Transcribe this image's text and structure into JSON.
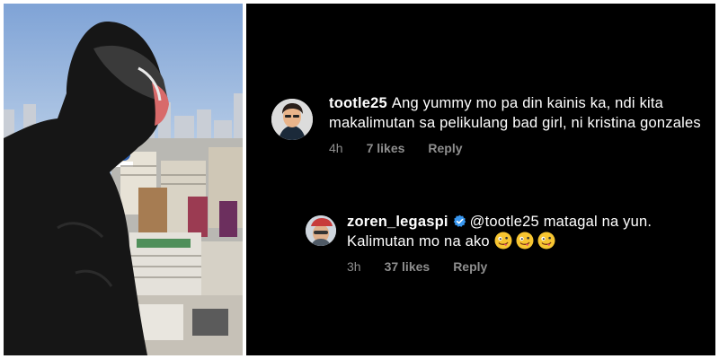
{
  "comment": {
    "username": "tootle25",
    "text": "Ang yummy mo pa din kainis ka, ndi kita makalimutan sa pelikulang bad girl, ni kristina gonzales",
    "time": "4h",
    "likes": "7 likes",
    "reply_label": "Reply"
  },
  "reply": {
    "username": "zoren_legaspi",
    "mention": "@tootle25",
    "text": "matagal na yun. Kalimutan mo na ako",
    "emoji_count": 3,
    "time": "3h",
    "likes": "37 likes",
    "reply_label": "Reply"
  },
  "icons": {
    "verified": "verified-badge-icon",
    "emoji": "zany-face-emoji"
  },
  "colors": {
    "panel_bg": "#000000",
    "meta_text": "#8e8e8e",
    "verified_blue": "#3897f0"
  }
}
